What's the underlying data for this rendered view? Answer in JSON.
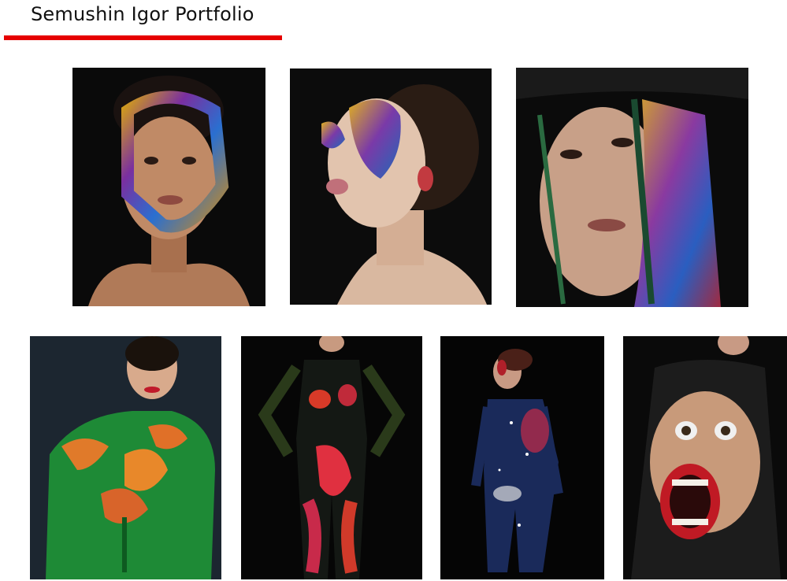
{
  "header": {
    "title": "Semushin Igor Portfolio",
    "accent_color": "#e60000"
  },
  "gallery": {
    "photos": [
      {
        "name": "photo-1",
        "description": "portrait with iridescent painted frame around face"
      },
      {
        "name": "photo-2",
        "description": "profile portrait with blue and gold glitter eye mask"
      },
      {
        "name": "photo-3",
        "description": "close-up portrait with black wrap and multicolor glitter stripe"
      },
      {
        "name": "photo-4",
        "description": "green body paint with orange calla lily flowers"
      },
      {
        "name": "photo-5",
        "description": "full body paint with red flowers on black"
      },
      {
        "name": "photo-6",
        "description": "full body cosmic galaxy paint"
      },
      {
        "name": "photo-7",
        "description": "body paint of screaming face with red lips"
      }
    ]
  }
}
